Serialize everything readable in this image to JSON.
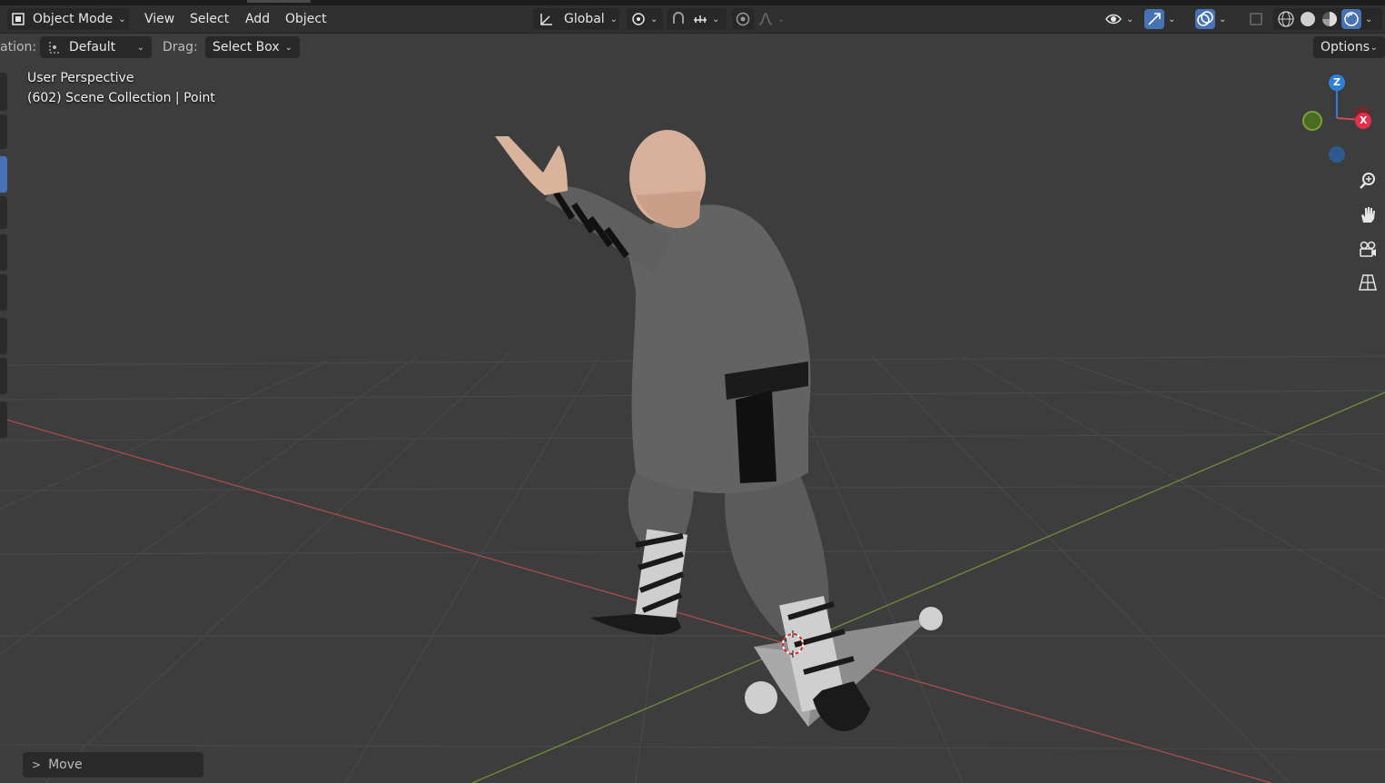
{
  "header": {
    "mode_label": "Object Mode",
    "menus": [
      "View",
      "Select",
      "Add",
      "Object"
    ],
    "transform_orientation": "Global",
    "options_label": "Options"
  },
  "tool_settings": {
    "orientation_label": "ation:",
    "orientation_value": "Default",
    "drag_label": "Drag:",
    "drag_value": "Select Box"
  },
  "viewport": {
    "view_name": "User Perspective",
    "collection_info": "(602) Scene Collection | Point"
  },
  "gizmo": {
    "z": "Z",
    "x": "X"
  },
  "operator_panel": {
    "label": "Move"
  },
  "colors": {
    "background": "#3d3d3d",
    "header": "#303030",
    "x_axis": "#c6504f",
    "y_axis": "#7ea03a",
    "z_axis": "#2e7fd9",
    "active_blue": "#4772b3"
  },
  "icons": [
    "object-mode-icon",
    "transform-orientation-icon",
    "pivot-icon",
    "snap-icon",
    "snap-target-icon",
    "proportional-edit-icon",
    "falloff-icon",
    "visibility-icon",
    "gizmo-icon",
    "overlay-icon",
    "xray-icon",
    "wireframe-shading-icon",
    "solid-shading-icon",
    "material-shading-icon",
    "rendered-shading-icon",
    "zoom-icon",
    "hand-pan-icon",
    "camera-view-icon",
    "grid-perspective-icon",
    "chevron-right-icon"
  ]
}
